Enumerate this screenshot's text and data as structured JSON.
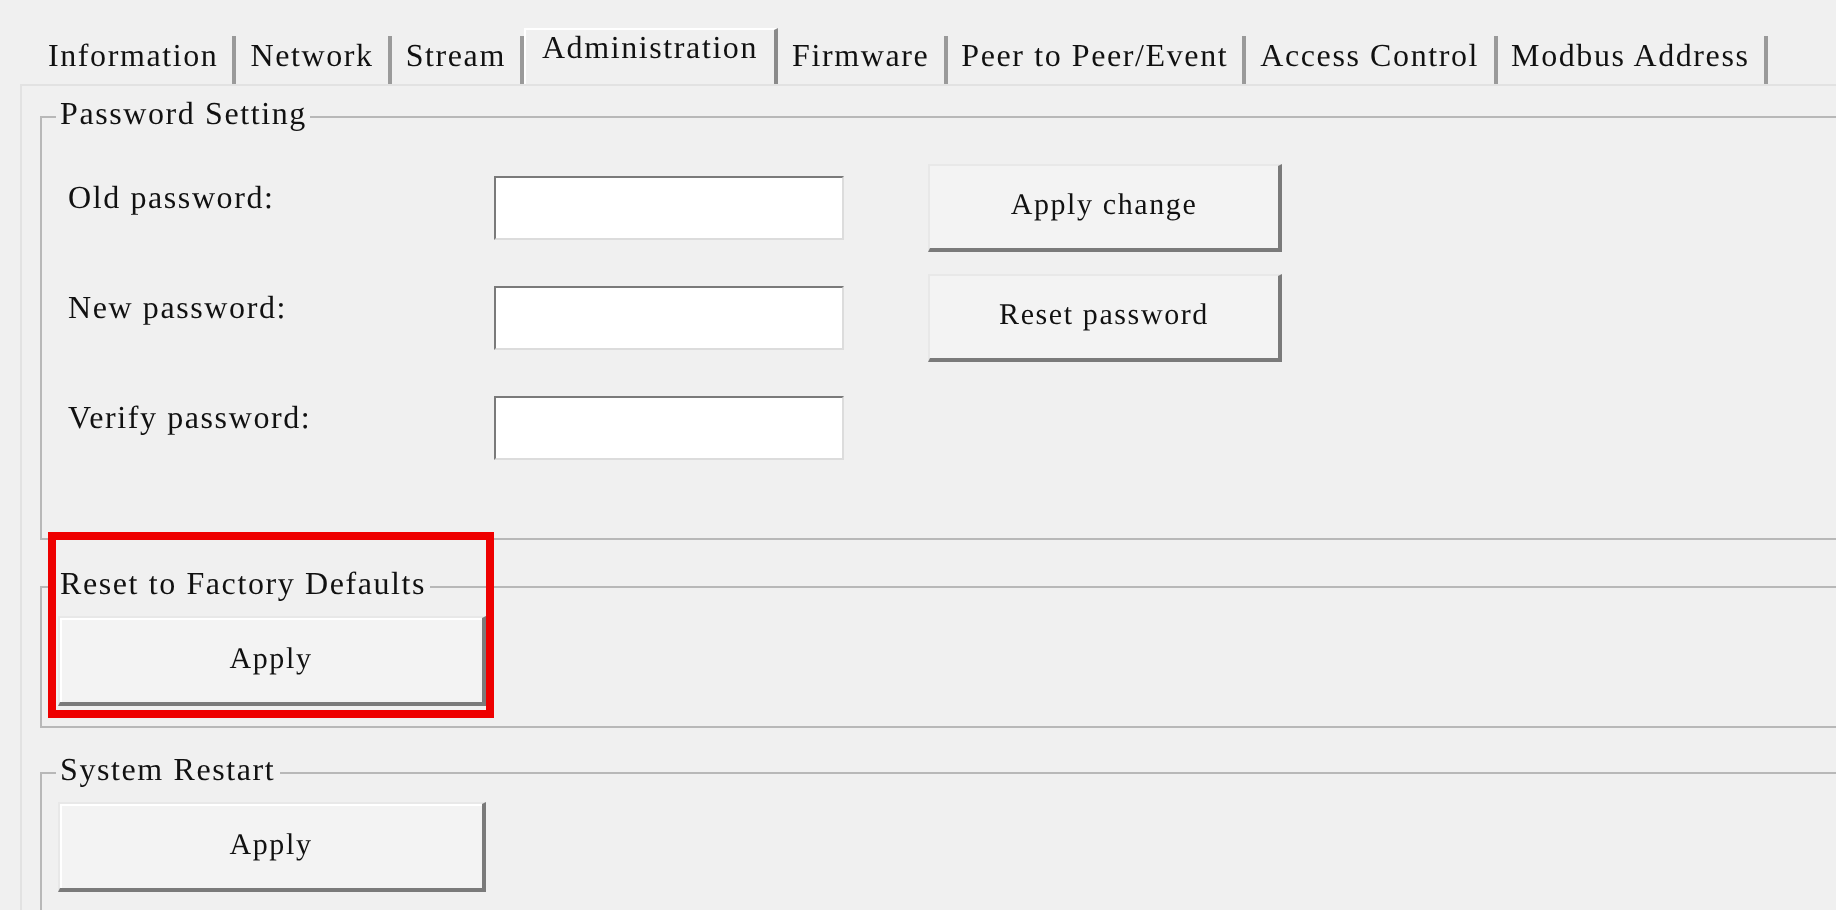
{
  "tabs": [
    {
      "label": "Information",
      "selected": false
    },
    {
      "label": "Network",
      "selected": false
    },
    {
      "label": "Stream",
      "selected": false
    },
    {
      "label": "Administration",
      "selected": true
    },
    {
      "label": "Firmware",
      "selected": false
    },
    {
      "label": "Peer to Peer/Event",
      "selected": false
    },
    {
      "label": "Access Control",
      "selected": false
    },
    {
      "label": "Modbus Address",
      "selected": false
    }
  ],
  "password_setting": {
    "title": "Password Setting",
    "fields": [
      {
        "label": "Old password:"
      },
      {
        "label": "New password:"
      },
      {
        "label": "Verify password:"
      }
    ],
    "buttons": [
      "Apply change",
      "Reset password"
    ]
  },
  "factory_reset": {
    "title": "Reset to Factory Defaults",
    "button": "Apply",
    "highlighted": true
  },
  "system_restart": {
    "title": "System Restart",
    "button": "Apply",
    "highlighted": false
  }
}
